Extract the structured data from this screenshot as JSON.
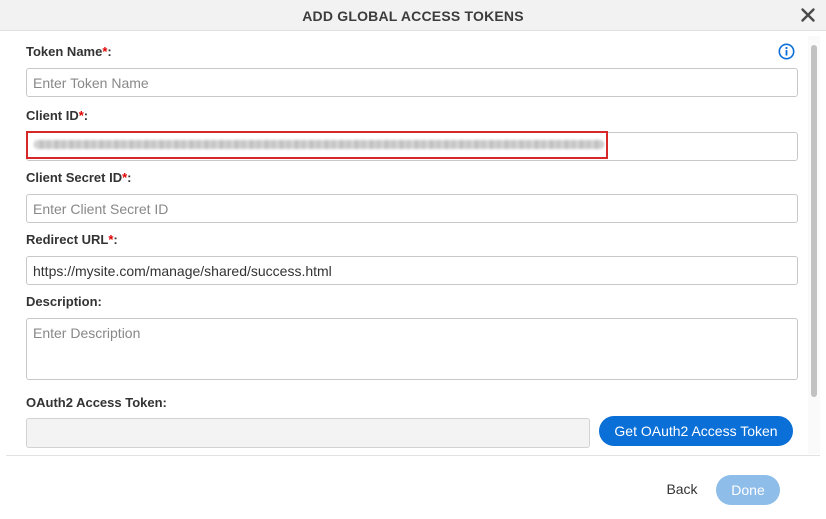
{
  "dialog": {
    "title": "ADD GLOBAL ACCESS TOKENS",
    "close_icon": "close-icon",
    "info_icon": "info-icon"
  },
  "form": {
    "token_name": {
      "label": "Token Name",
      "required_mark": "*",
      "suffix": ":",
      "placeholder": "Enter Token Name",
      "value": ""
    },
    "client_id": {
      "label": "Client ID",
      "required_mark": "*",
      "suffix": ":",
      "value_state": "redacted"
    },
    "client_secret": {
      "label": "Client Secret ID",
      "required_mark": "*",
      "suffix": ":",
      "placeholder": "Enter Client Secret ID",
      "value": ""
    },
    "redirect_url": {
      "label": "Redirect URL",
      "required_mark": "*",
      "suffix": ":",
      "value": "https://mysite.com/manage/shared/success.html"
    },
    "description": {
      "label": "Description:",
      "placeholder": "Enter Description",
      "value": ""
    },
    "oauth_token": {
      "label": "OAuth2 Access Token:",
      "value": ""
    }
  },
  "buttons": {
    "get_token": "Get OAuth2 Access Token",
    "back": "Back",
    "done": "Done"
  },
  "colors": {
    "primary": "#0a6fd6",
    "primary_disabled": "#8fbde9",
    "required": "#e00000",
    "highlight": "#d62828"
  }
}
